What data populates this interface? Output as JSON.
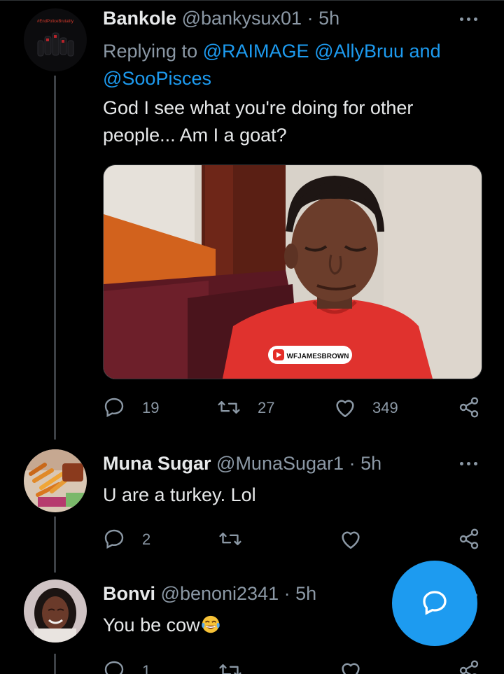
{
  "tweets": [
    {
      "name": "Bankole",
      "handle": "@bankysux01",
      "separator": "·",
      "time": "5h",
      "replying_prefix": "Replying to",
      "mention_1": "@RAIMAGE",
      "mention_2": "@AllyBruu",
      "and_word": "and",
      "mention_3": "@SooPisces",
      "text": "God I see what you're doing for other people... Am I a goat?",
      "avatar_label": "#EndPoliceBrutality",
      "media_watermark": "WFJAMESBROWN",
      "replies": "19",
      "retweets": "27",
      "likes": "349",
      "icons": [
        "reply-icon",
        "retweet-icon",
        "like-icon",
        "share-icon",
        "more-icon"
      ]
    },
    {
      "name": "Muna Sugar",
      "handle": "@MunaSugar1",
      "separator": "·",
      "time": "5h",
      "text": "U are a turkey. Lol",
      "replies": "2",
      "retweets": "",
      "likes": ""
    },
    {
      "name": "Bonvi",
      "handle": "@benoni2341",
      "separator": "·",
      "time": "5h",
      "text": "You be cow",
      "emoji": "face-with-tears-of-joy",
      "replies": "1",
      "retweets": "",
      "likes": ""
    }
  ],
  "fab": {
    "icon": "compose-reply-icon"
  },
  "colors": {
    "background": "#000000",
    "accent": "#1d9bf0",
    "text_primary": "#e7e9ea",
    "text_secondary": "#8b98a5",
    "thread_line": "#3d4146"
  }
}
